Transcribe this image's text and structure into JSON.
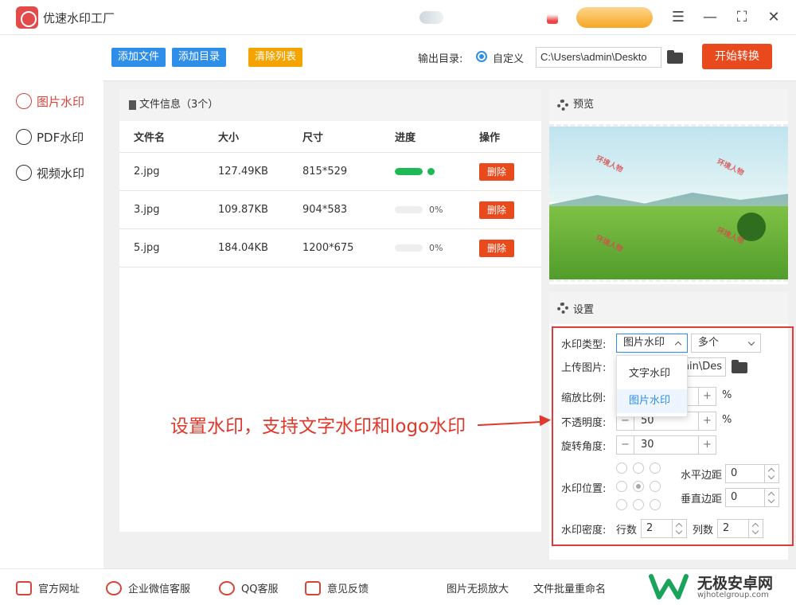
{
  "app": {
    "title": "优速水印工厂"
  },
  "window_controls": {
    "menu": "☰",
    "minimize": "—",
    "maximize": "⛶",
    "close": "✕"
  },
  "sidebar": {
    "items": [
      {
        "label": "图片水印",
        "active": true
      },
      {
        "label": "PDF水印",
        "active": false
      },
      {
        "label": "视频水印",
        "active": false
      }
    ]
  },
  "toolbar": {
    "add_file": "添加文件",
    "add_dir": "添加目录",
    "clear_list": "清除列表",
    "output_label": "输出目录:",
    "output_option": "自定义",
    "output_path": "C:\\Users\\admin\\Deskto",
    "start": "开始转换"
  },
  "file_panel": {
    "title": "文件信息（3个）",
    "columns": [
      "文件名",
      "大小",
      "尺寸",
      "进度",
      "操作"
    ],
    "rows": [
      {
        "name": "2.jpg",
        "size": "127.49KB",
        "dims": "815*529",
        "progress": 1.0,
        "pct": "",
        "action": "删除"
      },
      {
        "name": "3.jpg",
        "size": "109.87KB",
        "dims": "904*583",
        "progress": 0,
        "pct": "0%",
        "action": "删除"
      },
      {
        "name": "5.jpg",
        "size": "184.04KB",
        "dims": "1200*675",
        "progress": 0,
        "pct": "0%",
        "action": "删除"
      }
    ]
  },
  "preview": {
    "title": "预览",
    "watermark_text": "环境人物"
  },
  "settings": {
    "title": "设置",
    "wm_type_label": "水印类型:",
    "wm_type_value": "图片水印",
    "wm_count_value": "多个",
    "dropdown_options": [
      "文字水印",
      "图片水印"
    ],
    "upload_label": "上传图片:",
    "upload_value": "min\\Des",
    "scale_label": "缩放比例:",
    "opacity_label": "不透明度:",
    "opacity_value": "50",
    "rotation_label": "旋转角度:",
    "rotation_value": "30",
    "percent": "%",
    "position_label": "水印位置:",
    "h_margin_label": "水平边距",
    "h_margin_value": "0",
    "v_margin_label": "垂直边距",
    "v_margin_value": "0",
    "density_label": "水印密度:",
    "rows_label": "行数",
    "rows_value": "2",
    "cols_label": "列数",
    "cols_value": "2"
  },
  "annotation": "设置水印，支持文字水印和logo水印",
  "footer": {
    "items": [
      "官方网址",
      "企业微信客服",
      "QQ客服",
      "意见反馈"
    ],
    "links": [
      "图片无损放大",
      "文件批量重命名"
    ],
    "brand": "无极安卓网",
    "brand_url": "wjhotelgroup.com"
  },
  "colors": {
    "accent_red": "#e8491d",
    "blue": "#2f8ee8",
    "orange": "#f5a300",
    "green": "#1db954",
    "annotation": "#e0392b"
  }
}
